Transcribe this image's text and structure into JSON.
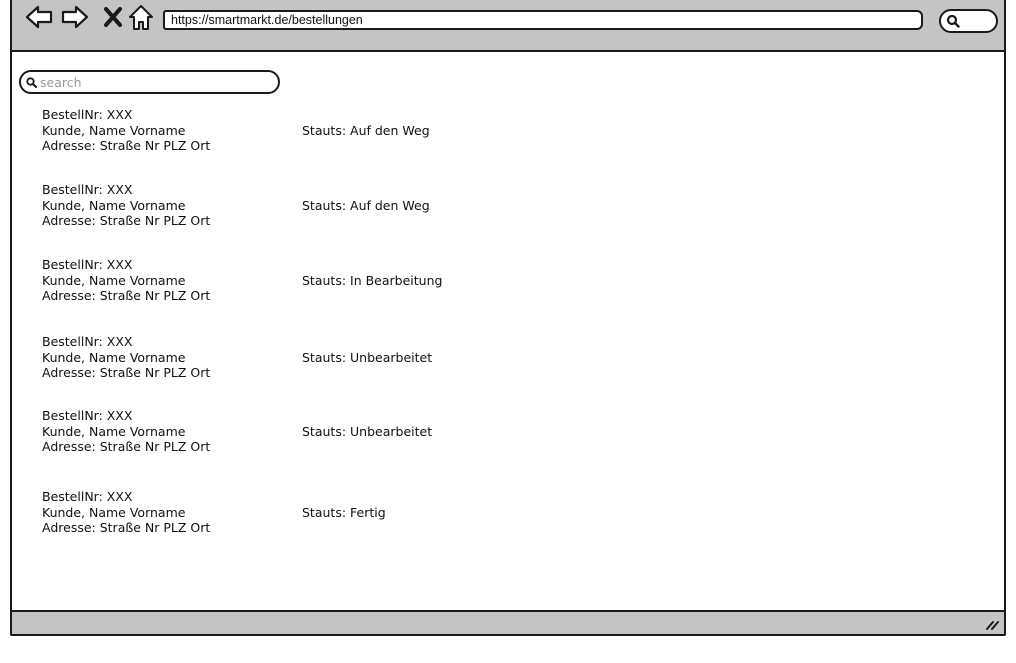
{
  "browser": {
    "url": "https://smartmarkt.de/bestellungen",
    "icons": [
      "back-icon",
      "forward-icon",
      "close-icon",
      "home-icon",
      "search-icon"
    ]
  },
  "search": {
    "placeholder": "search"
  },
  "orders": [
    {
      "nr": "BestellNr: XXX",
      "kunde": "Kunde,  Name Vorname",
      "adresse": "Adresse: Straße Nr PLZ Ort",
      "status": "Stauts: Auf den Weg"
    },
    {
      "nr": "BestellNr: XXX",
      "kunde": "Kunde,  Name Vorname",
      "adresse": "Adresse: Straße Nr PLZ Ort",
      "status": "Stauts: Auf den Weg"
    },
    {
      "nr": "BestellNr: XXX",
      "kunde": "Kunde,  Name Vorname",
      "adresse": "Adresse: Straße Nr PLZ Ort",
      "status": "Stauts: In Bearbeitung"
    },
    {
      "nr": "BestellNr: XXX",
      "kunde": "Kunde,  Name Vorname",
      "adresse": "Adresse: Straße Nr PLZ Ort",
      "status": "Stauts: Unbearbeitet"
    },
    {
      "nr": "BestellNr: XXX",
      "kunde": "Kunde,  Name Vorname",
      "adresse": "Adresse: Straße Nr PLZ Ort",
      "status": "Stauts: Unbearbeitet"
    },
    {
      "nr": "BestellNr: XXX",
      "kunde": "Kunde,  Name Vorname",
      "adresse": "Adresse: Straße Nr PLZ Ort",
      "status": "Stauts: Fertig"
    }
  ],
  "colors": {
    "chrome": "#c4c4c4",
    "border": "#1a1a1a",
    "background": "#ffffff"
  }
}
